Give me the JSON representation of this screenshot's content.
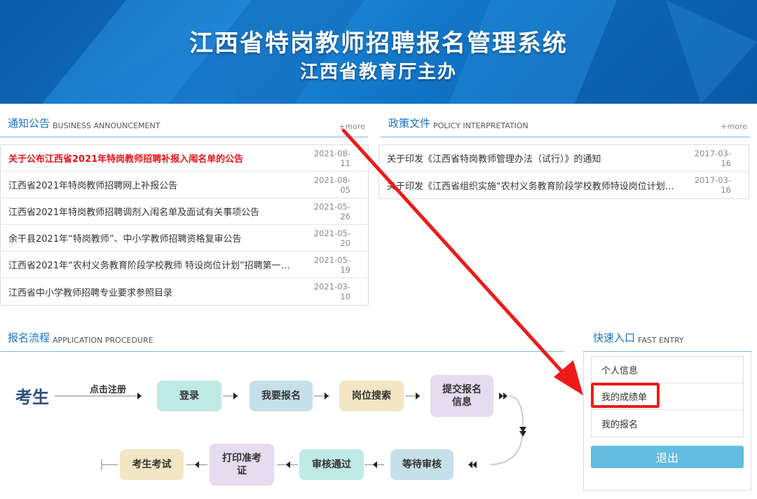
{
  "header": {
    "title": "江西省特岗教师招聘报名管理系统",
    "subtitle": "江西省教育厅主办"
  },
  "announcements": {
    "title_cn": "通知公告",
    "title_en": "BUSINESS ANNOUNCEMENT",
    "more": "+more",
    "items": [
      {
        "title": "关于公布江西省2021年特岗教师招聘补报入闱名单的公告",
        "date": "2021-08-11",
        "highlight": true
      },
      {
        "title": "江西省2021年特岗教师招聘网上补报公告",
        "date": "2021-08-05"
      },
      {
        "title": "江西省2021年特岗教师招聘调剂入闱名单及面试有关事项公告",
        "date": "2021-05-26"
      },
      {
        "title": "余干县2021年“特岗教师”、中小学教师招聘资格复审公告",
        "date": "2021-05-20"
      },
      {
        "title": "江西省2021年“农村义务教育阶段学校教师 特设岗位计划”招聘第一批…",
        "date": "2021-05-19"
      },
      {
        "title": "江西省中小学教师招聘专业要求参照目录",
        "date": "2021-03-10"
      }
    ]
  },
  "policy": {
    "title_cn": "政策文件",
    "title_en": "POLICY INTERPRETATION",
    "more": "+more",
    "items": [
      {
        "title": "关于印发《江西省特岗教师管理办法（试行）》的通知",
        "date": "2017-03-16"
      },
      {
        "title": "关于印发《江西省组织实施“农村义务教育阶段学校教师特设岗位计划”…",
        "date": "2017-03-16"
      }
    ]
  },
  "procedure": {
    "title_cn": "报名流程",
    "title_en": "APPLICATION PROCEDURE",
    "start": "考生",
    "click_register": "点击注册",
    "steps": {
      "login": "登录",
      "apply": "我要报名",
      "search": "岗位搜索",
      "submit": "提交报名信息",
      "wait": "等待审核",
      "approved": "审核通过",
      "print": "打印准考证",
      "exam": "考生考试"
    }
  },
  "quick_entry": {
    "title_cn": "快速入口",
    "title_en": "FAST ENTRY",
    "items": [
      "个人信息",
      "我的成绩单",
      "我的报名"
    ],
    "logout": "退出"
  },
  "colors": {
    "accent_blue": "#1a73c2",
    "highlight_red": "#e8141b",
    "annotation_red": "#ee1a1a",
    "logout_button": "#62bde0"
  }
}
